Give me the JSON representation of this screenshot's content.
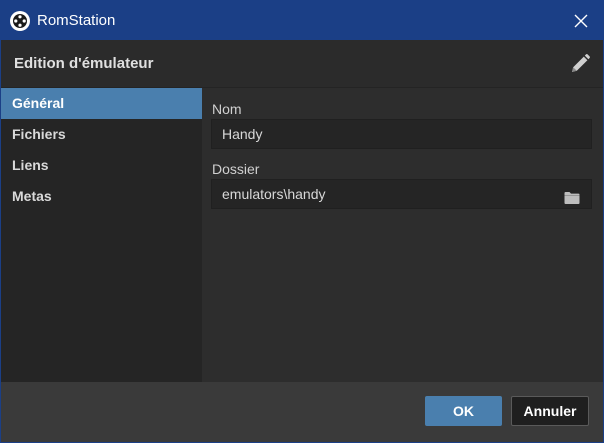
{
  "window": {
    "title": "RomStation"
  },
  "header": {
    "title": "Edition d'émulateur"
  },
  "sidebar": {
    "items": [
      {
        "label": "Général",
        "active": true
      },
      {
        "label": "Fichiers",
        "active": false
      },
      {
        "label": "Liens",
        "active": false
      },
      {
        "label": "Metas",
        "active": false
      }
    ]
  },
  "form": {
    "name": {
      "label": "Nom",
      "value": "Handy"
    },
    "folder": {
      "label": "Dossier",
      "value": "emulators\\handy"
    }
  },
  "footer": {
    "ok_label": "OK",
    "cancel_label": "Annuler"
  },
  "icons": {
    "app": "romstation-logo-icon",
    "close": "close-icon",
    "edit": "pencil-icon",
    "folder": "folder-icon"
  },
  "colors": {
    "titlebar": "#1b3f86",
    "accent": "#4a7fae",
    "background": "#2d2d2d"
  }
}
